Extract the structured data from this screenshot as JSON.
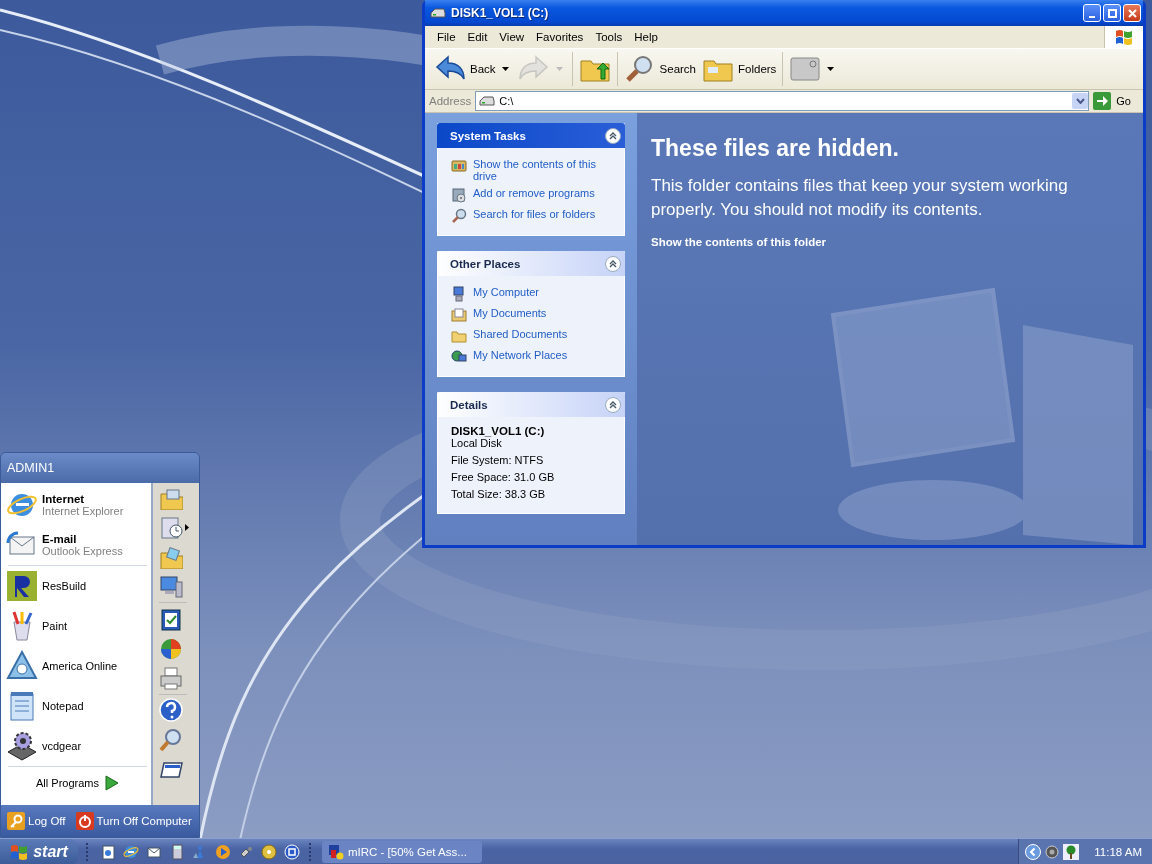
{
  "explorer": {
    "title": "DISK1_VOL1 (C:)",
    "menu": [
      "File",
      "Edit",
      "View",
      "Favorites",
      "Tools",
      "Help"
    ],
    "toolbar": [
      {
        "kind": "back",
        "label": "Back",
        "disabled": false,
        "dropdown": true
      },
      {
        "kind": "forward",
        "disabled": true,
        "dropdown": true
      },
      {
        "kind": "up",
        "disabled": false,
        "dropdown": false
      },
      {
        "kind": "search",
        "label": "Search",
        "disabled": false,
        "dropdown": false
      },
      {
        "kind": "folders",
        "label": "Folders",
        "disabled": false,
        "dropdown": false
      },
      {
        "kind": "views",
        "disabled": false,
        "dropdown": true
      }
    ],
    "address": {
      "label": "Address",
      "value": "C:\\",
      "go": "Go"
    },
    "panels": [
      {
        "kind": "tasks",
        "title": "System Tasks",
        "expanded": true,
        "items": [
          {
            "label": "Show the contents of this drive"
          },
          {
            "label": "Add or remove programs"
          },
          {
            "label": "Search for files or folders"
          }
        ]
      },
      {
        "kind": "tasks",
        "title": "Other Places",
        "expanded": true,
        "items": [
          {
            "label": "My Computer"
          },
          {
            "label": "My Documents"
          },
          {
            "label": "Shared Documents"
          },
          {
            "label": "My Network Places"
          }
        ]
      },
      {
        "kind": "details",
        "title": "Details",
        "expanded": true,
        "name": "DISK1_VOL1 (C:)",
        "type": "Local Disk",
        "lines": [
          "File System: NTFS",
          "Free Space: 31.0 GB",
          "Total Size: 38.3 GB"
        ]
      }
    ],
    "info": {
      "heading": "These files are hidden.",
      "text": "This folder contains files that keep your system working properly. You should not modify its contents.",
      "link": "Show the contents of this folder"
    }
  },
  "start_menu": {
    "user": "ADMIN1",
    "pinned": [
      {
        "title": "Internet",
        "subtitle": "Internet Explorer"
      },
      {
        "title": "E-mail",
        "subtitle": "Outlook Express"
      }
    ],
    "recent": [
      {
        "label": "ResBuild"
      },
      {
        "label": "Paint"
      },
      {
        "label": "America Online"
      },
      {
        "label": "Notepad"
      },
      {
        "label": "vcdgear"
      }
    ],
    "all_programs": "All Programs",
    "footer": [
      {
        "kind": "logoff",
        "label": "Log Off"
      },
      {
        "kind": "shutdown",
        "label": "Turn Off Computer"
      }
    ]
  },
  "taskbar": {
    "start": "start",
    "tasks": [
      {
        "label": "mIRC - [50% Get Ass...",
        "selected": false
      }
    ],
    "clock": "11:18 AM"
  }
}
